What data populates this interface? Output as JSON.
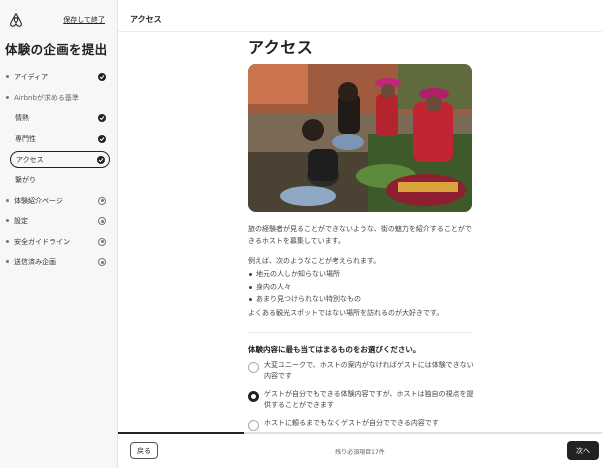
{
  "sidebar": {
    "logo_icon": "airbnb-logo",
    "save_exit": "保存して終了",
    "title": "体験の企画を提出",
    "items": [
      {
        "label": "アイディア",
        "status": "done"
      },
      {
        "label": "Airbnbが求める基準",
        "status": "header"
      },
      {
        "label": "情熱",
        "status": "done"
      },
      {
        "label": "専門性",
        "status": "done"
      },
      {
        "label": "アクセス",
        "status": "done"
      },
      {
        "label": "繋がり",
        "status": "none"
      },
      {
        "label": "体験紹介ページ",
        "status": "open"
      },
      {
        "label": "設定",
        "status": "open"
      },
      {
        "label": "安全ガイドライン",
        "status": "open"
      },
      {
        "label": "送信済み企画",
        "status": "open"
      }
    ]
  },
  "header": {
    "title": "アクセス"
  },
  "main": {
    "title": "アクセス",
    "intro": "旅の経験者が見ることができないような、街の魅力を紹介することができるホストを募集しています。",
    "lead": "例えば、次のようなことが考えられます。",
    "bullets": [
      "地元の人しか知らない場所",
      "身内の人々",
      "あまり見つけられない特別なもの"
    ],
    "closing": "よくある観光スポットではない場所を訪れるのが大好きです。",
    "question": "体験内容に最も当てはまるものをお選びください。",
    "options": [
      {
        "label": "大変ユニークで、ホストの案内がなければゲストには体験できない内容です",
        "selected": false
      },
      {
        "label": "ゲストが自分でもできる体験内容ですが、ホストは独自の視点を提供することができます",
        "selected": true
      },
      {
        "label": "ホストに頼るまでもなくゲストが自分でできる内容です",
        "selected": false
      }
    ]
  },
  "footer": {
    "back": "戻る",
    "remaining": "残り必須項目17件",
    "next": "次へ",
    "progress": 0.26
  },
  "colors": {
    "accent": "#222222",
    "sidebar_bg": "#f7f7f7",
    "logo": "#222222"
  }
}
